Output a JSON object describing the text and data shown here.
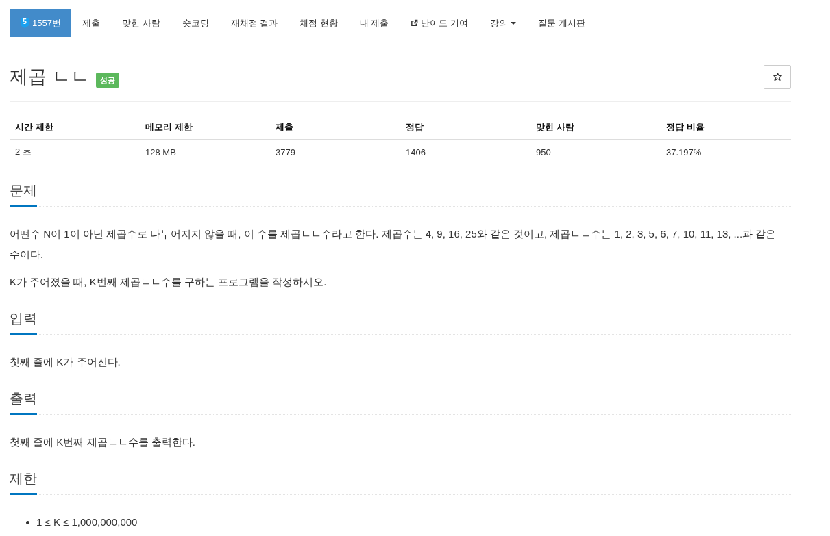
{
  "nav": {
    "tabs": [
      {
        "kind": "problem",
        "badge": "5",
        "label": "1557번",
        "selected": true
      },
      {
        "kind": "plain",
        "label": "제출",
        "selected": false
      },
      {
        "kind": "plain",
        "label": "맞힌 사람",
        "selected": false
      },
      {
        "kind": "plain",
        "label": "숏코딩",
        "selected": false
      },
      {
        "kind": "plain",
        "label": "재채점 결과",
        "selected": false
      },
      {
        "kind": "plain",
        "label": "채점 현황",
        "selected": false
      },
      {
        "kind": "plain",
        "label": "내 제출",
        "selected": false
      },
      {
        "kind": "external",
        "label": "난이도 기여",
        "selected": false
      },
      {
        "kind": "dropdown",
        "label": "강의",
        "selected": false
      },
      {
        "kind": "plain",
        "label": "질문 게시판",
        "selected": false
      }
    ]
  },
  "problem": {
    "title": "제곱 ㄴㄴ",
    "status": "성공"
  },
  "stats_table": {
    "columns": [
      "시간 제한",
      "메모리 제한",
      "제출",
      "정답",
      "맞힌 사람",
      "정답 비율"
    ],
    "rows": [
      [
        "2 초",
        "128 MB",
        "3779",
        "1406",
        "950",
        "37.197%"
      ]
    ]
  },
  "sections": [
    {
      "heading": "문제",
      "blocks": [
        {
          "kind": "paragraph",
          "text": "어떤수 N이 1이 아닌 제곱수로 나누어지지 않을 때, 이 수를 제곱ㄴㄴ수라고 한다. 제곱수는 4, 9, 16, 25와 같은 것이고, 제곱ㄴㄴ수는 1, 2, 3, 5, 6, 7, 10, 11, 13, ...과 같은 수이다."
        },
        {
          "kind": "paragraph",
          "text": "K가 주어졌을 때, K번째 제곱ㄴㄴ수를 구하는 프로그램을 작성하시오."
        }
      ]
    },
    {
      "heading": "입력",
      "blocks": [
        {
          "kind": "paragraph",
          "text": "첫째 줄에 K가 주어진다."
        }
      ]
    },
    {
      "heading": "출력",
      "blocks": [
        {
          "kind": "paragraph",
          "text": "첫째 줄에 K번째 제곱ㄴㄴ수를 출력한다."
        }
      ]
    },
    {
      "heading": "제한",
      "blocks": [
        {
          "kind": "bullet",
          "text": "1 ≤ K ≤ 1,000,000,000"
        }
      ]
    }
  ]
}
